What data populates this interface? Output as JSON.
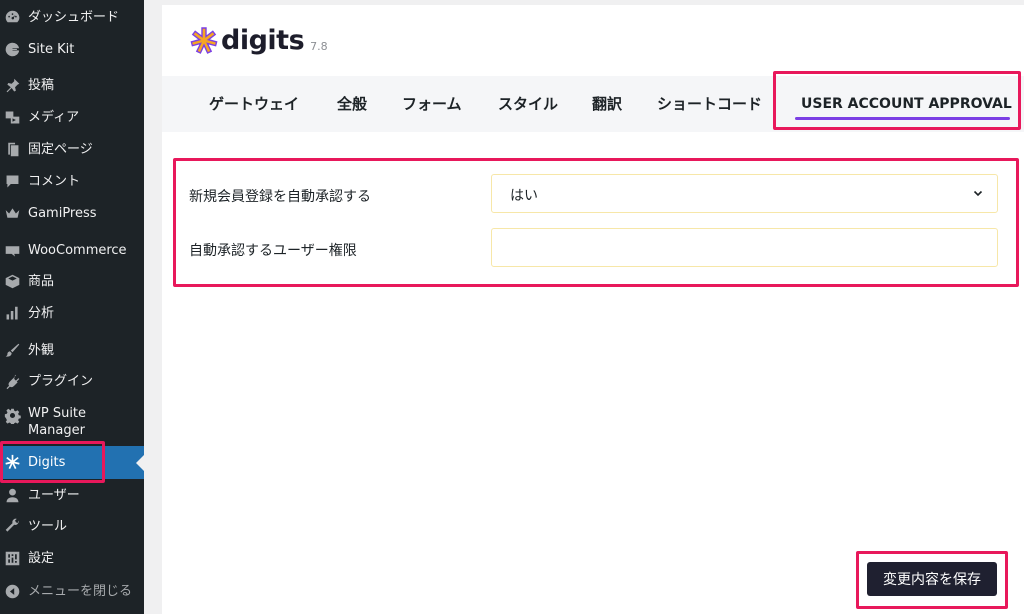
{
  "sidebar": {
    "items": [
      {
        "label": "ダッシュボード",
        "icon": "dashboard-icon"
      },
      {
        "label": "Site Kit",
        "icon": "google-g-icon"
      },
      {
        "label": "投稿",
        "icon": "pin-icon"
      },
      {
        "label": "メディア",
        "icon": "media-icon"
      },
      {
        "label": "固定ページ",
        "icon": "page-icon"
      },
      {
        "label": "コメント",
        "icon": "comment-icon"
      },
      {
        "label": "GamiPress",
        "icon": "crown-icon"
      },
      {
        "label": "WooCommerce",
        "icon": "woo-icon"
      },
      {
        "label": "商品",
        "icon": "box-icon"
      },
      {
        "label": "分析",
        "icon": "bar-chart-icon"
      },
      {
        "label": "外観",
        "icon": "brush-icon"
      },
      {
        "label": "プラグイン",
        "icon": "plug-icon"
      },
      {
        "label": "WP Suite Manager",
        "icon": "gear-icon"
      },
      {
        "label": "Digits",
        "icon": "digits-asterisk-icon"
      },
      {
        "label": "ユーザー",
        "icon": "user-icon"
      },
      {
        "label": "ツール",
        "icon": "wrench-icon"
      },
      {
        "label": "設定",
        "icon": "settings-sliders-icon"
      }
    ],
    "collapse_label": "メニューを閉じる",
    "active_color": "#2271b1"
  },
  "brand": {
    "name": "digits",
    "version": "7.8",
    "accent": "#f5a623"
  },
  "tabs": [
    {
      "label": "ゲートウェイ"
    },
    {
      "label": "全般"
    },
    {
      "label": "フォーム"
    },
    {
      "label": "スタイル"
    },
    {
      "label": "翻訳"
    },
    {
      "label": "ショートコード"
    },
    {
      "label": "USER ACCOUNT APPROVAL"
    }
  ],
  "active_tab_underline_color": "#7b3fe4",
  "settings": {
    "auto_approve": {
      "label": "新規会員登録を自動承認する",
      "value": "はい"
    },
    "approve_role": {
      "label": "自動承認するユーザー権限",
      "value": ""
    }
  },
  "save_label": "変更内容を保存",
  "highlight_color": "#e8185b"
}
